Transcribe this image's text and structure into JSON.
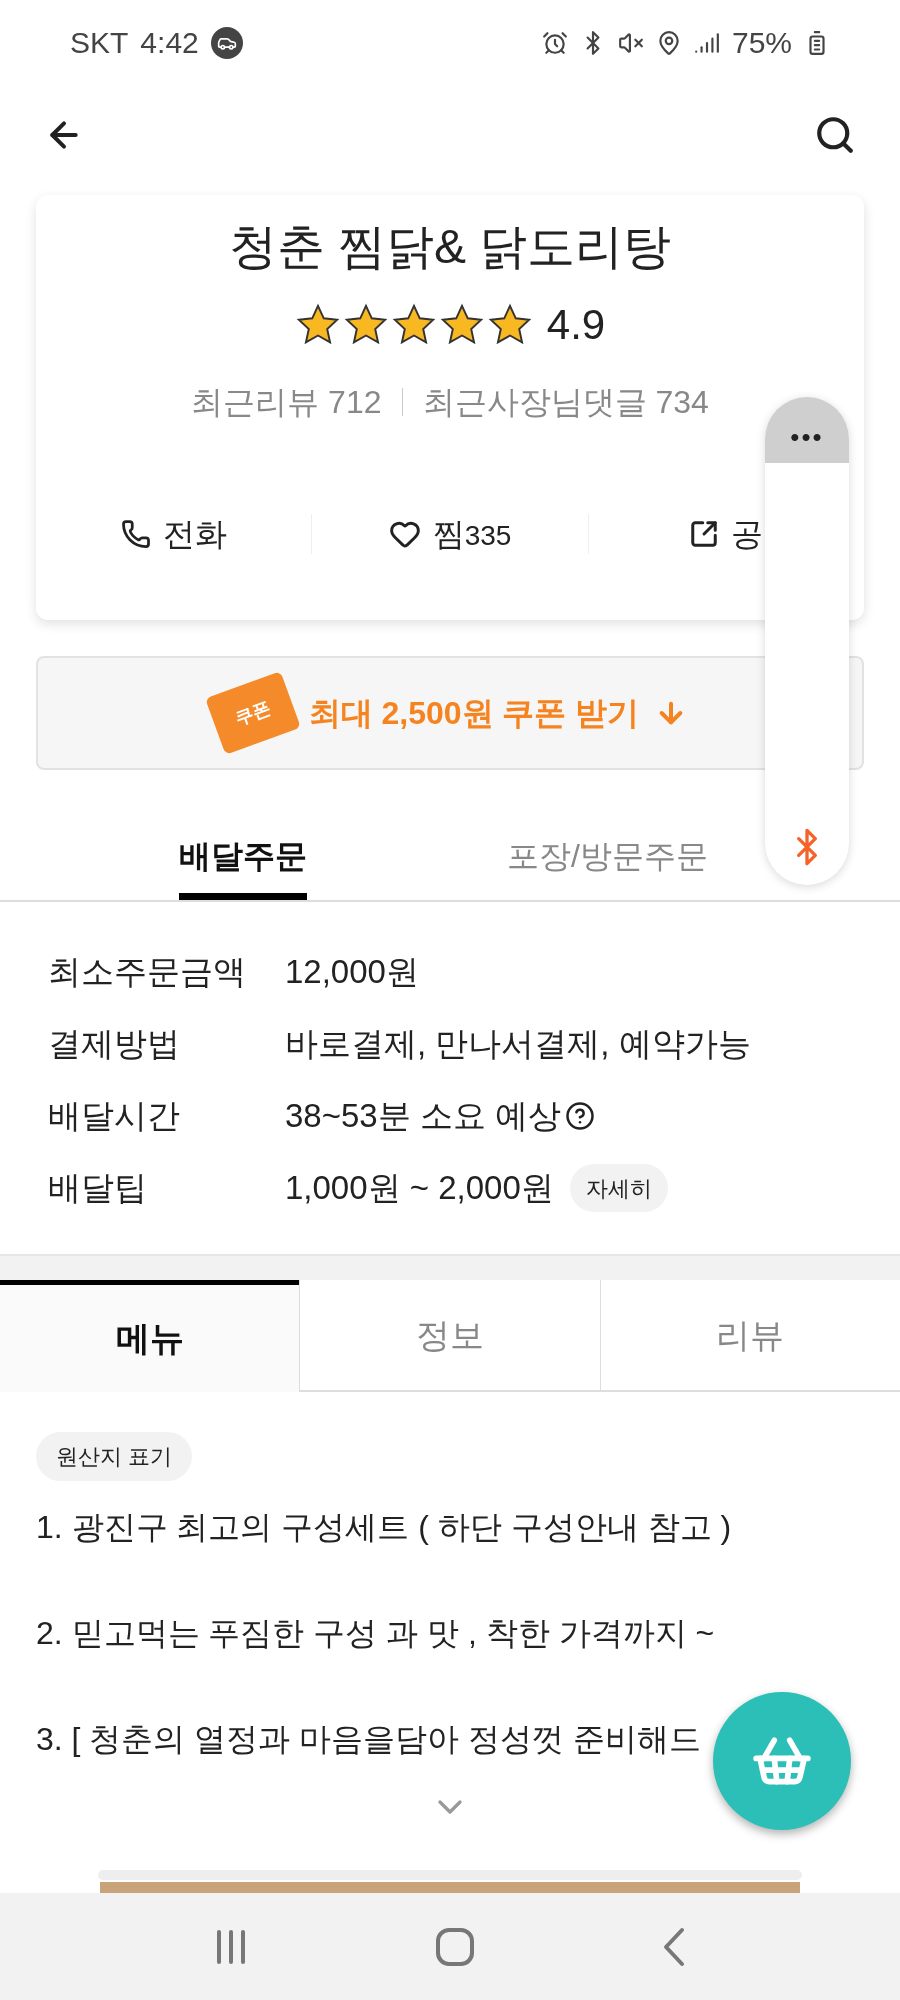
{
  "status_bar": {
    "carrier": "SKT",
    "time": "4:42",
    "battery": "75%"
  },
  "store": {
    "name": "청춘 찜닭& 닭도리탕",
    "stars": 5,
    "rating": "4.9",
    "reviews": "최근리뷰 712",
    "owner_replies": "최근사장님댓글 734",
    "actions": [
      {
        "kind": "phone",
        "label": "전화"
      },
      {
        "kind": "heart",
        "label": "찜",
        "count": "335"
      },
      {
        "kind": "share",
        "label": "공"
      }
    ]
  },
  "floating_panel": {
    "menu": "•••"
  },
  "coupon": {
    "badge": "쿠폰",
    "label": "최대 2,500원 쿠폰 받기"
  },
  "order_tabs": [
    {
      "label": "배달주문",
      "selected": true
    },
    {
      "label": "포장/방문주문",
      "selected": false
    }
  ],
  "info": [
    {
      "label": "최소주문금액",
      "value": "12,000원"
    },
    {
      "label": "결제방법",
      "value": "바로결제, 만나서결제, 예약가능"
    },
    {
      "label": "배달시간",
      "value": "38~53분 소요 예상",
      "help": true
    },
    {
      "label": "배달팁",
      "value": "1,000원 ~ 2,000원",
      "button": "자세히"
    }
  ],
  "tabs": [
    {
      "label": "메뉴",
      "selected": true
    },
    {
      "label": "정보",
      "selected": false
    },
    {
      "label": "리뷰",
      "selected": false
    }
  ],
  "menu_notice": {
    "chip": "원산지 표기",
    "lines": [
      "1. 광진구 최고의 구성세트 ( 하단 구성안내 참고 )",
      "2. 믿고먹는 푸짐한 구성 과 맛 , 착한 가격까지 ~",
      "3. [ 청춘의 열정과 마음을담아 정성껏 준비해드"
    ]
  }
}
